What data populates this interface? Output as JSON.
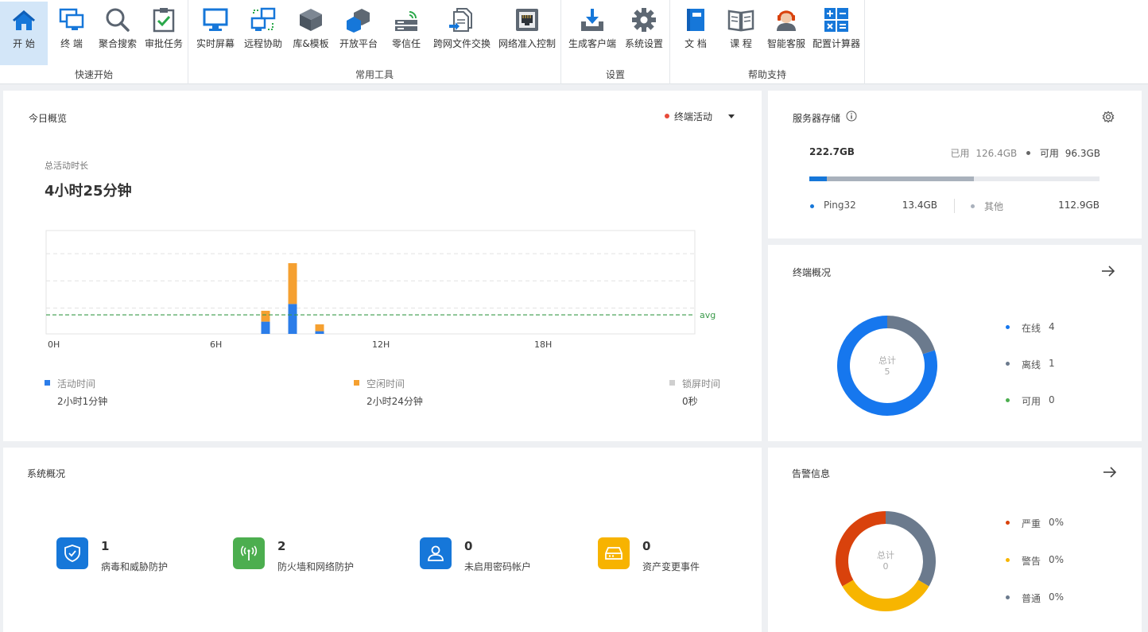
{
  "ribbon": {
    "groups": [
      {
        "label": "快速开始",
        "tools": [
          {
            "label": "开 始",
            "icon": "home-icon",
            "active": true
          },
          {
            "label": "终 端",
            "icon": "terminal-monitor-icon"
          },
          {
            "label": "聚合搜索",
            "icon": "search-icon"
          },
          {
            "label": "审批任务",
            "icon": "clipboard-check-icon"
          }
        ]
      },
      {
        "label": "常用工具",
        "tools": [
          {
            "label": "实时屏幕",
            "icon": "monitor-icon"
          },
          {
            "label": "远程协助",
            "icon": "remote-desktop-icon"
          },
          {
            "label": "库&模板",
            "icon": "cube-icon"
          },
          {
            "label": "开放平台",
            "icon": "blocks-icon"
          },
          {
            "label": "零信任",
            "icon": "router-icon"
          },
          {
            "label": "跨网文件交换",
            "icon": "file-transfer-icon"
          },
          {
            "label": "网络准入控制",
            "icon": "network-port-icon"
          }
        ]
      },
      {
        "label": "设置",
        "tools": [
          {
            "label": "生成客户端",
            "icon": "download-tray-icon"
          },
          {
            "label": "系统设置",
            "icon": "gear-icon"
          }
        ]
      },
      {
        "label": "帮助支持",
        "tools": [
          {
            "label": "文 档",
            "icon": "book-icon"
          },
          {
            "label": "课 程",
            "icon": "open-book-icon"
          },
          {
            "label": "智能客服",
            "icon": "headset-agent-icon"
          },
          {
            "label": "配置计算器",
            "icon": "calculator-icon"
          }
        ]
      }
    ]
  },
  "today": {
    "title": "今日概览",
    "filter_label": "终端活动",
    "total_label": "总活动时长",
    "total_value": "4小时25分钟",
    "avg_label": "avg",
    "legend": [
      {
        "name": "活动时间",
        "value": "2小时1分钟",
        "color": "#2b7de9"
      },
      {
        "name": "空闲时间",
        "value": "2小时24分钟",
        "color": "#f5a030"
      },
      {
        "name": "锁屏时间",
        "value": "0秒",
        "color": "#cfcfcf"
      }
    ]
  },
  "chart_data": {
    "type": "bar",
    "stacked": true,
    "x_ticks": [
      "0H",
      "6H",
      "12H",
      "18H"
    ],
    "x_range": [
      0,
      24
    ],
    "categories_hours": [
      8,
      9,
      10
    ],
    "series": [
      {
        "name": "活动时间",
        "color": "#2b7de9",
        "values": [
          0.45,
          1.1,
          0.1
        ]
      },
      {
        "name": "空闲时间",
        "color": "#f5a030",
        "values": [
          0.4,
          1.5,
          0.25
        ]
      }
    ],
    "ylim": [
      0,
      3.8
    ],
    "avg": 0.7,
    "grid": true
  },
  "storage": {
    "title": "服务器存储",
    "total": "222.7GB",
    "used_label": "已用",
    "used_value": "126.4GB",
    "free_label": "可用",
    "free_value": "96.3GB",
    "used_fraction": 0.568,
    "ping32_fraction": 0.06,
    "ping32_label": "Ping32",
    "ping32_value": "13.4GB",
    "other_label": "其他",
    "other_value": "112.9GB",
    "color_ping32": "#1677d9",
    "color_other": "#a9b1bc"
  },
  "terminals": {
    "title": "终端概况",
    "center_label": "总计",
    "center_value": "5",
    "items": [
      {
        "name": "在线",
        "value": "4",
        "count": 4,
        "color": "#1677ee"
      },
      {
        "name": "离线",
        "value": "1",
        "count": 1,
        "color": "#6b7a8d"
      },
      {
        "name": "可用",
        "value": "0",
        "count": 0,
        "color": "#4cae4f"
      }
    ]
  },
  "system": {
    "title": "系统概况",
    "items": [
      {
        "num": "1",
        "label": "病毒和威胁防护",
        "icon": "shield-icon",
        "color": "#1677d9"
      },
      {
        "num": "2",
        "label": "防火墙和网络防护",
        "icon": "wireless-antenna-icon",
        "color": "#4cae4f"
      },
      {
        "num": "0",
        "label": "未启用密码帐户",
        "icon": "user-icon",
        "color": "#1677d9"
      },
      {
        "num": "0",
        "label": "资产变更事件",
        "icon": "hard-drive-icon",
        "color": "#f7b300"
      }
    ]
  },
  "alerts": {
    "title": "告警信息",
    "center_label": "总计",
    "center_value": "0",
    "items": [
      {
        "name": "严重",
        "value": "0%",
        "color": "#d9420c"
      },
      {
        "name": "警告",
        "value": "0%",
        "color": "#f7b500"
      },
      {
        "name": "普通",
        "value": "0%",
        "color": "#6b7a8d"
      }
    ]
  }
}
